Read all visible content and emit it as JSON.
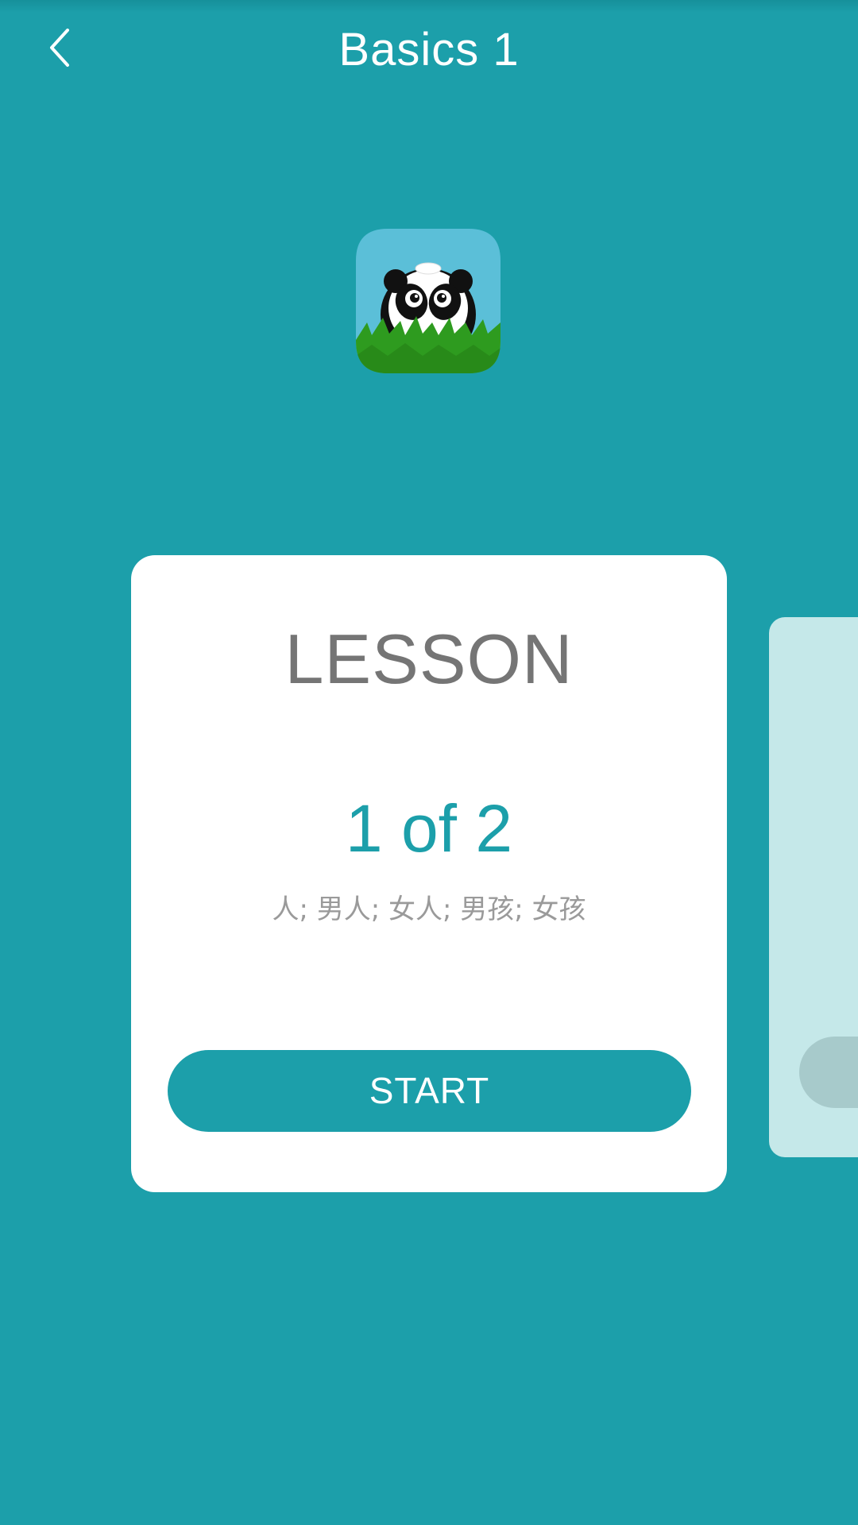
{
  "header": {
    "title": "Basics 1",
    "back_icon": "chevron-left-icon"
  },
  "skill_icon": "panda-icon",
  "lesson_card": {
    "heading": "LESSON",
    "counter": "1 of 2",
    "words": "人; 男人; 女人; 男孩; 女孩",
    "start_label": "START"
  },
  "colors": {
    "background": "#1c9faa",
    "card": "#ffffff",
    "heading_text": "#757575",
    "accent": "#1c9faa",
    "words_text": "#9a9a9a",
    "next_card": "#c5e8e9",
    "next_card_button": "#a7cacb"
  }
}
